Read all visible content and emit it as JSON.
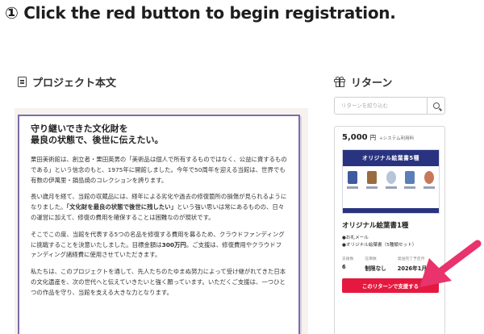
{
  "instruction": "① Click the red button to begin registration.",
  "story_section": {
    "heading": "プロジェクト本文",
    "heading_icon": "document-icon",
    "title": "守り継いできた文化財を\n最良の状態で、後世に伝えたい。",
    "paragraphs": [
      [
        "栗田美術館は、創立者・栗田英男の「美術品は個人で所有するものではなく、公益に資するものである」という信念のもと、1975年に開館しました。今年で50周年を迎える当館は、世界でも有数の伊萬里・鍋島焼のコレクションを誇ります。"
      ],
      [
        "長い歳月を経て、当館の収蔵品には、経年による劣化や過去の修復箇所の損傷が見られるようになりました。",
        "「文化財を最良の状態で後世に残したい」",
        "という強い思いは常にあるものの、日々の運営に加えて、修復の費用を確保することは困難なのが現状です。"
      ],
      [
        "そこでこの度、当館を代表する5つの名品を修復する費用を募るため、クラウドファンディングに挑戦することを決意いたしました。目標金額は",
        "300万円",
        "。ご支援は、修復費用やクラウドファンディング諸経費に使用させていただきます。"
      ],
      [
        "私たちは、このプロジェクトを通して、先人たちのたゆまぬ努力によって受け継がれてきた日本の文化遺産を、次の世代へと伝えていきたいと強く願っています。いただくご支援は、一つひとつの作品を守り、当館を支える大きな力となります。"
      ]
    ]
  },
  "reward_section": {
    "heading": "リターン",
    "heading_icon": "gift-icon",
    "search_placeholder": "リターンを絞り込む",
    "search_icon": "magnifier-icon",
    "card": {
      "price": "5,000",
      "price_unit": "円",
      "price_note": "+システム利用料",
      "image_banner": "オリジナル絵葉書5種",
      "name": "オリジナル絵葉書1種",
      "items": [
        "●お礼メール",
        "●オリジナル絵葉書（5種類セット）"
      ],
      "stats": [
        {
          "label": "支援数",
          "value": "6"
        },
        {
          "label": "在庫数",
          "value": "制限なし"
        },
        {
          "label": "発送完了予定月",
          "value": "2026年1月"
        }
      ],
      "button_label": "このリターンで支援する",
      "button_color": "#e5193f"
    }
  },
  "colors": {
    "accent_red": "#e5193f",
    "arrow_pink": "#e8336d",
    "banner_navy": "#2a3380",
    "card_border": "#7b6ea8"
  }
}
